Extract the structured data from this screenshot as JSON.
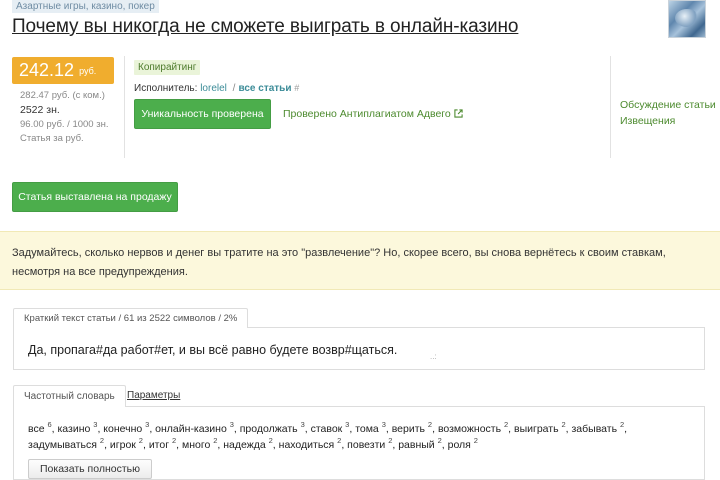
{
  "category_tag": "Азартные игры, казино, покер",
  "title": "Почему вы никогда не сможете выиграть в онлайн-казино",
  "price": {
    "value": "242.12",
    "currency": "руб.",
    "commission_line": "282.47 руб. (с ком.)",
    "chars_line": "2522 зн.",
    "rate_line": "96.00 руб. / 1000 зн.",
    "per_article_line": "Статья за руб."
  },
  "article_meta": {
    "label": "Копирайтинг",
    "performer_prefix": "Исполнитель:",
    "performer_name": "lorelel",
    "separator": "/",
    "all_articles": "все статьи",
    "hash": "#",
    "uniqueness_button": "Уникальность проверена",
    "checked_link": "Проверено Антиплагиатом Адвего"
  },
  "side_links": {
    "discussion": "Обсуждение статьи",
    "notices": "Извещения"
  },
  "sale_button": "Статья выставлена на продажу",
  "notice_text": "Задумайтесь, сколько нервов и денег вы тратите на это \"развлечение\"? Но, скорее всего, вы снова вернётесь к своим ставкам, несмотря на все предупреждения.",
  "short_text_tab": {
    "label": "Краткий текст статьи",
    "count": "61 из 2522 символов",
    "percent": "2%",
    "sep": "/",
    "content": "Да, пропага#да работ#ет, и вы всё равно будете возвр#щаться."
  },
  "frequency": {
    "tab_active": "Частотный словарь",
    "tab_params": "Параметры",
    "words": [
      {
        "w": "все",
        "n": "6"
      },
      {
        "w": "казино",
        "n": "3"
      },
      {
        "w": "конечно",
        "n": "3"
      },
      {
        "w": "онлайн-казино",
        "n": "3"
      },
      {
        "w": "продолжать",
        "n": "3"
      },
      {
        "w": "ставок",
        "n": "3"
      },
      {
        "w": "тома",
        "n": "3"
      },
      {
        "w": "верить",
        "n": "2"
      },
      {
        "w": "возможность",
        "n": "2"
      },
      {
        "w": "выиграть",
        "n": "2"
      },
      {
        "w": "забывать",
        "n": "2"
      },
      {
        "w": "задумываться",
        "n": "2"
      },
      {
        "w": "игрок",
        "n": "2"
      },
      {
        "w": "итог",
        "n": "2"
      },
      {
        "w": "много",
        "n": "2"
      },
      {
        "w": "надежда",
        "n": "2"
      },
      {
        "w": "находиться",
        "n": "2"
      },
      {
        "w": "повезти",
        "n": "2"
      },
      {
        "w": "равный",
        "n": "2"
      },
      {
        "w": "роля",
        "n": "2"
      }
    ],
    "show_all_button": "Показать полностью"
  },
  "colors": {
    "price_badge": "#f0ad2e",
    "green_button": "#4cae4c",
    "notice_bg": "#fcf8dc",
    "link_green": "#4c8a2e",
    "link_teal": "#3c8c98"
  },
  "icons": {
    "external_link": "external-link-icon",
    "thumbnail": "article-thumbnail"
  }
}
